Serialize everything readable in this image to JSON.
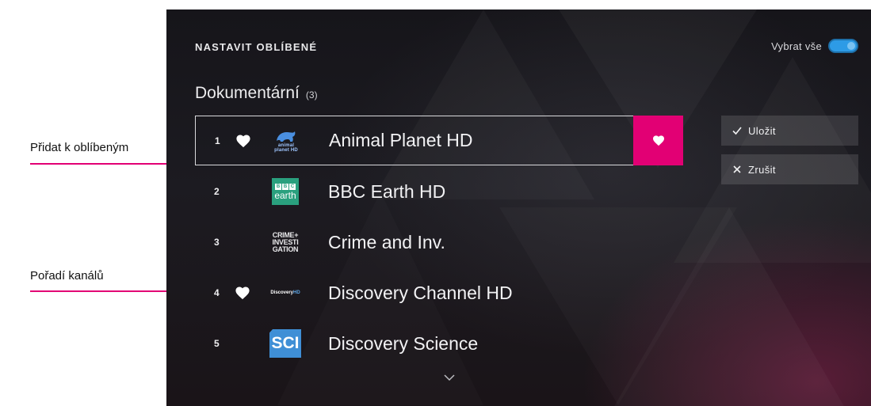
{
  "callouts": [
    {
      "label": "Přidat k oblíbeným"
    },
    {
      "label": "Pořadí kanálů"
    }
  ],
  "header": {
    "title": "NASTAVIT OBLÍBENÉ",
    "select_all_label": "Vybrat vše",
    "select_all_on": true
  },
  "category": {
    "name": "Dokumentární",
    "count": "(3)"
  },
  "channels": [
    {
      "number": "1",
      "name": "Animal Planet HD",
      "favorite": true,
      "logo": "animal-planet-hd-logo",
      "logo_text": [
        "animal",
        "planet HD"
      ]
    },
    {
      "number": "2",
      "name": "BBC Earth HD",
      "favorite": false,
      "logo": "bbc-earth-logo",
      "logo_text": [
        "B",
        "B",
        "C",
        "earth"
      ]
    },
    {
      "number": "3",
      "name": "Crime and Inv.",
      "favorite": false,
      "logo": "crime-investigation-logo",
      "logo_text": [
        "CRIME+",
        "INVESTI",
        "GATION"
      ]
    },
    {
      "number": "4",
      "name": "Discovery Channel HD",
      "favorite": true,
      "logo": "discovery-hd-logo",
      "logo_text": [
        "Discovery",
        "HD"
      ]
    },
    {
      "number": "5",
      "name": "Discovery Science",
      "favorite": false,
      "logo": "discovery-science-logo",
      "logo_text": [
        "SCI"
      ]
    }
  ],
  "actions": {
    "save_label": "Uložit",
    "cancel_label": "Zrušit"
  },
  "colors": {
    "accent": "#e20074",
    "toggle": "#2d9be6"
  }
}
